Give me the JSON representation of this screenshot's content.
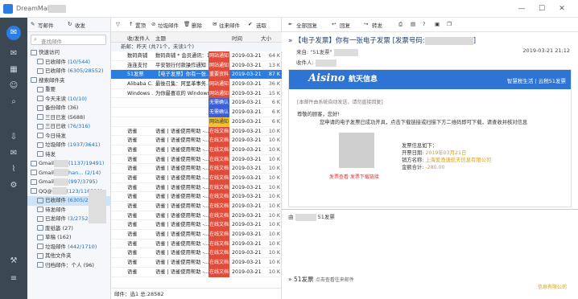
{
  "app": {
    "title": "DreamMail"
  },
  "window_controls": {
    "minimize": "—",
    "maximize": "☐",
    "close": "✕"
  },
  "folder_toolbar": {
    "compose": "写邮件",
    "receive": "收发"
  },
  "folder_search": {
    "placeholder": "查找邮件"
  },
  "tree": [
    {
      "label": "快速访问",
      "count": ""
    },
    {
      "label": "已收邮件 ",
      "count": "(10/544)"
    },
    {
      "label": "已收邮件 ",
      "count": "(6305/28552)"
    },
    {
      "label": "搜索邮件夹",
      "count": ""
    },
    {
      "label": "重要",
      "count": ""
    },
    {
      "label": "今天未读 ",
      "count": "(10/10)"
    },
    {
      "label": "备份邮件 ",
      "count": "(36)"
    },
    {
      "label": "三日已发 ",
      "count": "(5688)"
    },
    {
      "label": "三日已收 ",
      "count": "(76/316)"
    },
    {
      "label": "今日待发",
      "count": ""
    },
    {
      "label": "垃圾邮件 ",
      "count": "(1937/3641)"
    },
    {
      "label": "待发",
      "count": ""
    },
    {
      "label": "Gmail",
      "count": "(1137/19491)"
    },
    {
      "label": "Gmail",
      "count": "han... (2/14)"
    },
    {
      "label": "Gmail",
      "count": "(997/3795)"
    },
    {
      "label": "QQ@",
      "count": "(123/116532)"
    },
    {
      "label": "已收邮件 ",
      "count": "(6305/28552)"
    },
    {
      "label": "待发邮件",
      "count": ""
    },
    {
      "label": "已发邮件 ",
      "count": "(3/2752)"
    },
    {
      "label": "废纸篓 ",
      "count": "(27)"
    },
    {
      "label": "草稿 ",
      "count": "(162)"
    },
    {
      "label": "垃圾邮件 ",
      "count": "(442/1710)"
    },
    {
      "label": "其他文件夹",
      "count": ""
    },
    {
      "label": "归档邮件：个人 ",
      "count": "(96)"
    }
  ],
  "list_toolbar": {
    "filter": "▽",
    "archive": "置顶",
    "junk": "垃圾邮件",
    "delete": "删除",
    "correspond": "往来邮件",
    "select": "选取"
  },
  "list_header": {
    "from": "收/发件人",
    "subject": "主题",
    "date": "时间",
    "size": "大小"
  },
  "group_label": "新邮：昨天 (共71个，未读1个)",
  "mails": [
    {
      "from": "数码商铺",
      "subject": "数码商铺 * 会员通讯：1...",
      "tag": "网站通知",
      "tag_color": "red",
      "date": "2019-03-21",
      "size": "64 K"
    },
    {
      "from": "连连支付",
      "subject": "平安银行付款操作通知",
      "tag": "网站通知",
      "tag_color": "red",
      "date": "2019-03-21",
      "size": "13 K"
    },
    {
      "from": "51发票",
      "subject": "【电子发票】你有一张...",
      "tag": "重要资料",
      "tag_color": "red",
      "date": "2019-03-21",
      "size": "87 K"
    },
    {
      "from": "Alibaba C...",
      "subject": "最後召集：阿里革事务…",
      "tag": "网站通知",
      "tag_color": "red",
      "date": "2019-03-21",
      "size": "36 K"
    },
    {
      "from": "Windows ...",
      "subject": "为你最喜欢的 Windows...",
      "tag": "网站通知",
      "tag_color": "red",
      "date": "2019-03-21",
      "size": "15 K"
    },
    {
      "from": "",
      "subject": "",
      "tag": "无需确认",
      "tag_color": "blue",
      "date": "2019-03-21",
      "size": "6 K"
    },
    {
      "from": "",
      "subject": "",
      "tag": "无需确认",
      "tag_color": "blue",
      "date": "2019-03-21",
      "size": "6 K"
    },
    {
      "from": "",
      "subject": "",
      "tag": "网站通知",
      "tag_color": "yellow",
      "date": "2019-03-21",
      "size": "6 K"
    },
    {
      "from": "语雀",
      "subject": "语雀 | 语雀使用帮助 -...",
      "tag": "在线文档",
      "tag_color": "red",
      "date": "2019-03-21",
      "size": "10 K"
    },
    {
      "from": "语雀",
      "subject": "语雀 | 语雀使用帮助 -...",
      "tag": "在线文档",
      "tag_color": "red",
      "date": "2019-03-21",
      "size": "10 K"
    },
    {
      "from": "语雀",
      "subject": "语雀 | 语雀使用帮助 -...",
      "tag": "在线文档",
      "tag_color": "red",
      "date": "2019-03-21",
      "size": "10 K"
    },
    {
      "from": "语雀",
      "subject": "语雀 | 语雀使用帮助 -...",
      "tag": "在线文档",
      "tag_color": "red",
      "date": "2019-03-21",
      "size": "10 K"
    },
    {
      "from": "语雀",
      "subject": "语雀 | 语雀使用帮助 -...",
      "tag": "在线文档",
      "tag_color": "red",
      "date": "2019-03-21",
      "size": "10 K"
    },
    {
      "from": "语雀",
      "subject": "语雀 | 语雀使用帮助 -...",
      "tag": "在线文档",
      "tag_color": "red",
      "date": "2019-03-21",
      "size": "10 K"
    },
    {
      "from": "语雀",
      "subject": "语雀 | 语雀使用帮助 -...",
      "tag": "在线文档",
      "tag_color": "red",
      "date": "2019-03-21",
      "size": "10 K"
    },
    {
      "from": "语雀",
      "subject": "语雀 | 语雀使用帮助 -...",
      "tag": "在线文档",
      "tag_color": "red",
      "date": "2019-03-21",
      "size": "10 K"
    },
    {
      "from": "语雀",
      "subject": "语雀 | 语雀使用帮助 -...",
      "tag": "在线文档",
      "tag_color": "red",
      "date": "2019-03-21",
      "size": "10 K"
    },
    {
      "from": "语雀",
      "subject": "语雀 | 语雀使用帮助 -...",
      "tag": "在线文档",
      "tag_color": "red",
      "date": "2019-03-21",
      "size": "10 K"
    },
    {
      "from": "语雀",
      "subject": "语雀 | 语雀使用帮助 -...",
      "tag": "在线文档",
      "tag_color": "red",
      "date": "2019-03-21",
      "size": "10 K"
    },
    {
      "from": "语雀",
      "subject": "语雀 | 语雀使用帮助 -...",
      "tag": "在线文档",
      "tag_color": "red",
      "date": "2019-03-21",
      "size": "10 K"
    },
    {
      "from": "语雀",
      "subject": "语雀 | 语雀使用帮助 -...",
      "tag": "在线文档",
      "tag_color": "red",
      "date": "2019-03-21",
      "size": "10 K"
    },
    {
      "from": "语雀",
      "subject": "语雀 | 语雀使用帮助 -...",
      "tag": "在线文档",
      "tag_color": "red",
      "date": "2019-03-21",
      "size": "10 K"
    },
    {
      "from": "语雀",
      "subject": "语雀 | 语雀使用帮助 -...",
      "tag": "在线文档",
      "tag_color": "red",
      "date": "2019-03-21",
      "size": "10 K"
    },
    {
      "from": "语雀",
      "subject": "语雀 | 语雀使用帮助 -...",
      "tag": "在线文档",
      "tag_color": "red",
      "date": "2019-03-21",
      "size": "10 K"
    }
  ],
  "list_status": "邮件：选1 总:28582",
  "read_toolbar": {
    "reply_all": "全部回复",
    "reply": "回复",
    "forward": "转发"
  },
  "read": {
    "subject": "【电子发票】你有一张电子发票 [发票号码:",
    "subject_end": "]",
    "from_label": "来自:",
    "from_name": "\"51发票\"",
    "to_label": "收件人:",
    "date": "2019-03-21 21:12",
    "brand": "Aisino",
    "brand_cn": "航天信息",
    "tagline": "智慧税生活 | 云税51发票",
    "notice": "[本邮件由系统自动发送，请勿直接回复]",
    "greeting": "尊敬的顾客，您好!",
    "message": "您申请的电子发票已成功开具，点击下载链接或扫描下方二维码即可下载，请查收并核对信息",
    "links": "发票查看   发票下载链接",
    "info_title": "发票信息如下：",
    "info_date_label": "开票日期: ",
    "info_date": "2019年03月21日",
    "info_seller_label": "销方名称: ",
    "info_seller": "上海爱渔速航天信息有限公司",
    "info_amount_label": "金额合计: ",
    "info_amount": "-280.00",
    "footer_from_label": "由",
    "footer_from_name": "51发票",
    "attach_name": "51发票",
    "attach_hint": "点击查看往来邮件",
    "foot_note": "信息有限公司"
  }
}
